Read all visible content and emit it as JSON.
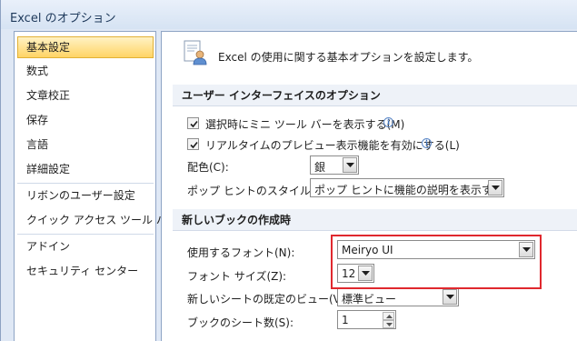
{
  "window": {
    "title": "Excel のオプション"
  },
  "sidebar": {
    "items": [
      {
        "label": "基本設定",
        "active": true
      },
      {
        "label": "数式"
      },
      {
        "label": "文章校正"
      },
      {
        "label": "保存"
      },
      {
        "label": "言語"
      },
      {
        "label": "詳細設定"
      },
      {
        "label": "リボンのユーザー設定"
      },
      {
        "label": "クイック アクセス ツール バー"
      },
      {
        "label": "アドイン"
      },
      {
        "label": "セキュリティ センター"
      }
    ]
  },
  "main": {
    "header_text": "Excel の使用に関する基本オプションを設定します。",
    "ui_section": {
      "title": "ユーザー インターフェイスのオプション",
      "mini_toolbar_label": "選択時にミニ ツール バーを表示する(M)",
      "mini_toolbar_checked": true,
      "live_preview_label": "リアルタイムのプレビュー表示機能を有効にする(L)",
      "live_preview_checked": true,
      "color_scheme_label": "配色(C):",
      "color_scheme_value": "銀",
      "screentip_label": "ポップ ヒントのスタイル(R):",
      "screentip_value": "ポップ ヒントに機能の説明を表示する"
    },
    "new_workbook_section": {
      "title": "新しいブックの作成時",
      "font_label": "使用するフォント(N):",
      "font_value": "Meiryo UI",
      "font_size_label": "フォント サイズ(Z):",
      "font_size_value": "12",
      "default_view_label": "新しいシートの既定のビュー(V):",
      "default_view_value": "標準ビュー",
      "sheet_count_label": "ブックのシート数(S):",
      "sheet_count_value": "1"
    }
  },
  "icons": {
    "info": "i"
  },
  "colors": {
    "highlight": "#e0282e",
    "active_nav": "#ffd465"
  }
}
